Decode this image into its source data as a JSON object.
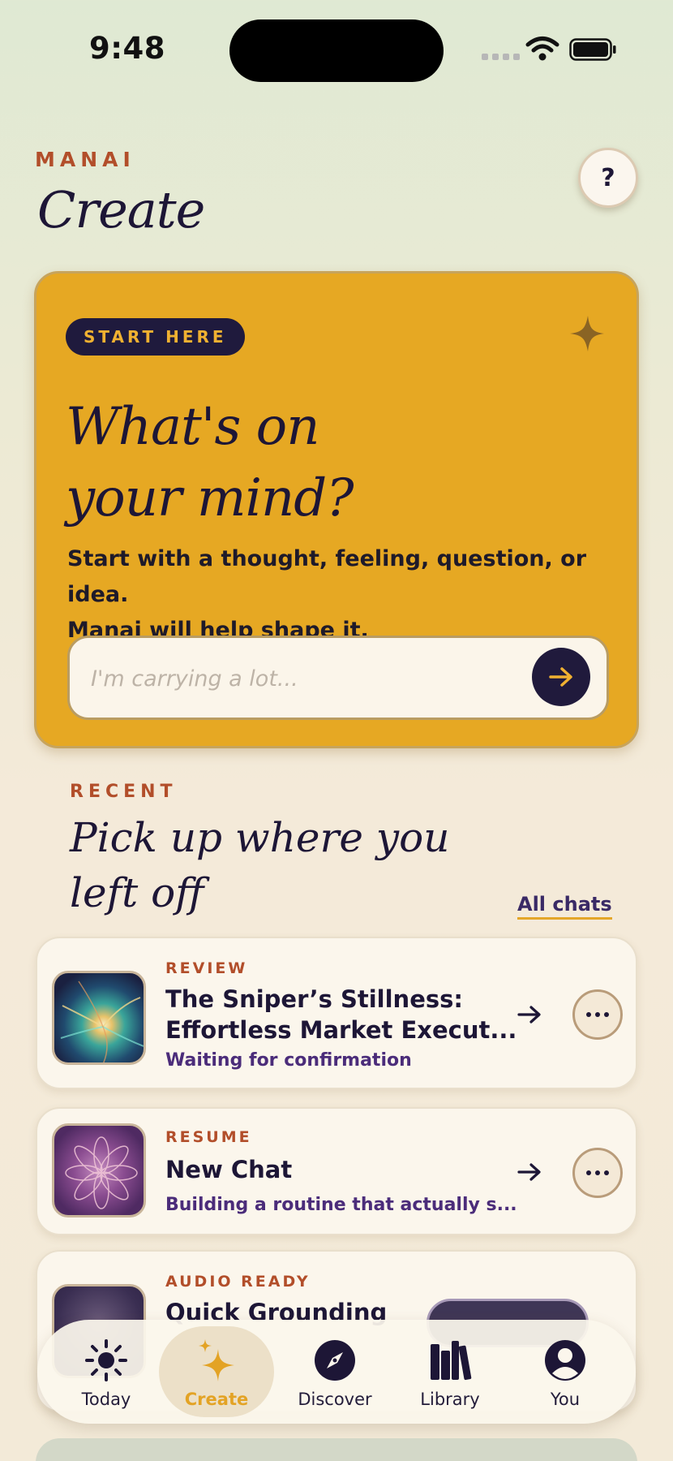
{
  "status_bar": {
    "time": "9:48"
  },
  "header": {
    "eyebrow": "MANAI",
    "title": "Create",
    "help_label": "?"
  },
  "hero": {
    "badge": "START HERE",
    "title_line1": "What's on",
    "title_line2": "your mind?",
    "subtitle_line1": "Start with a thought, feeling, question, or idea.",
    "subtitle_line2": "Manai will help shape it.",
    "input_placeholder": "I'm carrying a lot..."
  },
  "recent": {
    "eyebrow": "RECENT",
    "title_line1": "Pick up where you",
    "title_line2": "left off",
    "all_chats": "All chats",
    "items": [
      {
        "tag": "REVIEW",
        "title_line1": "The Sniper’s Stillness:",
        "title_line2": "Effortless Market Execut...",
        "subtitle": "Waiting for confirmation"
      },
      {
        "tag": "RESUME",
        "title_line1": "New Chat",
        "subtitle": "Building a routine that actually s..."
      },
      {
        "tag": "AUDIO READY",
        "title_line1": "Quick Grounding"
      }
    ]
  },
  "tabbar": {
    "items": [
      {
        "label": "Today",
        "icon": "sun-icon"
      },
      {
        "label": "Create",
        "icon": "sparkles-icon",
        "active": true
      },
      {
        "label": "Discover",
        "icon": "compass-icon"
      },
      {
        "label": "Library",
        "icon": "books-icon"
      },
      {
        "label": "You",
        "icon": "person-icon"
      }
    ]
  },
  "colors": {
    "accent": "#e6a823",
    "ink": "#1d1636",
    "eyebrow": "#b24e2a",
    "link": "#4b2c7a"
  }
}
